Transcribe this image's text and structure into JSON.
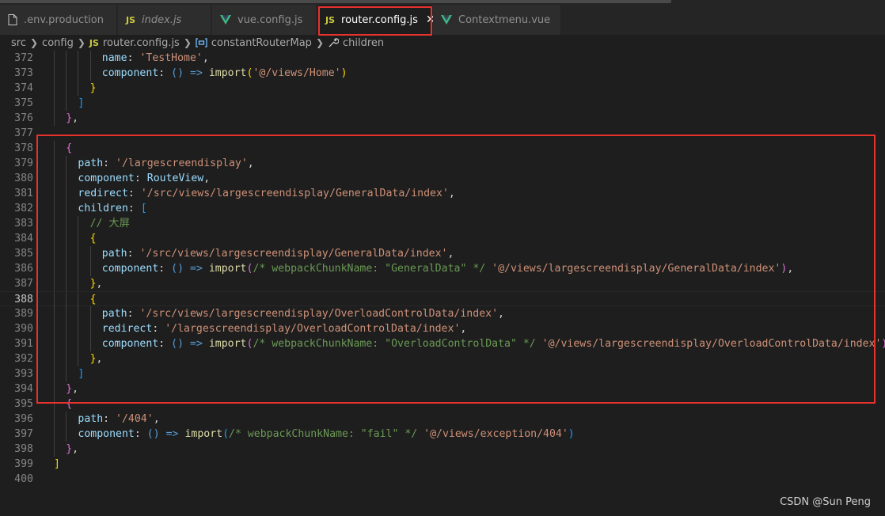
{
  "tabs": [
    {
      "label": ".env.production",
      "icon": "file-icon",
      "italic": false,
      "active": false
    },
    {
      "label": "index.js",
      "icon": "js-icon",
      "italic": true,
      "active": false
    },
    {
      "label": "vue.config.js",
      "icon": "vue-icon",
      "italic": false,
      "active": false
    },
    {
      "label": "router.config.js",
      "icon": "js-icon",
      "italic": false,
      "active": true
    },
    {
      "label": "Contextmenu.vue",
      "icon": "vue-icon",
      "italic": false,
      "active": false
    }
  ],
  "js_badge": "JS",
  "close_glyph": "✕",
  "breadcrumb": {
    "src": "src",
    "config": "config",
    "file": "router.config.js",
    "symbol1": "constantRouterMap",
    "symbol2": "children"
  },
  "lines": [
    {
      "n": "372",
      "indent": 4,
      "tokens": [
        [
          "k",
          "name"
        ],
        [
          "p",
          ": "
        ],
        [
          "s",
          "'TestHome'"
        ],
        [
          "p",
          ","
        ]
      ]
    },
    {
      "n": "373",
      "indent": 4,
      "tokens": [
        [
          "k",
          "component"
        ],
        [
          "p",
          ": "
        ],
        [
          "f",
          "()"
        ],
        [
          "p",
          " "
        ],
        [
          "f",
          "=>"
        ],
        [
          "p",
          " "
        ],
        [
          "fn",
          "import"
        ],
        [
          "b1",
          "("
        ],
        [
          "s",
          "'@/views/Home'"
        ],
        [
          "b1",
          ")"
        ]
      ]
    },
    {
      "n": "374",
      "indent": 3,
      "tokens": [
        [
          "b1",
          "}"
        ]
      ]
    },
    {
      "n": "375",
      "indent": 2,
      "tokens": [
        [
          "b3",
          "]"
        ]
      ]
    },
    {
      "n": "376",
      "indent": 1,
      "tokens": [
        [
          "b2",
          "}"
        ],
        [
          "p",
          ","
        ]
      ]
    },
    {
      "n": "377",
      "indent": 0,
      "tokens": []
    },
    {
      "n": "378",
      "indent": 1,
      "tokens": [
        [
          "b2",
          "{"
        ]
      ]
    },
    {
      "n": "379",
      "indent": 2,
      "tokens": [
        [
          "k",
          "path"
        ],
        [
          "p",
          ": "
        ],
        [
          "s",
          "'/largescreendisplay'"
        ],
        [
          "p",
          ","
        ]
      ]
    },
    {
      "n": "380",
      "indent": 2,
      "tokens": [
        [
          "k",
          "component"
        ],
        [
          "p",
          ": "
        ],
        [
          "k",
          "RouteView"
        ],
        [
          "p",
          ","
        ]
      ]
    },
    {
      "n": "381",
      "indent": 2,
      "tokens": [
        [
          "k",
          "redirect"
        ],
        [
          "p",
          ": "
        ],
        [
          "s",
          "'/src/views/largescreendisplay/GeneralData/index'"
        ],
        [
          "p",
          ","
        ]
      ]
    },
    {
      "n": "382",
      "indent": 2,
      "tokens": [
        [
          "k",
          "children"
        ],
        [
          "p",
          ": "
        ],
        [
          "b3",
          "["
        ]
      ]
    },
    {
      "n": "383",
      "indent": 3,
      "tokens": [
        [
          "c",
          "// 大屏"
        ]
      ]
    },
    {
      "n": "384",
      "indent": 3,
      "tokens": [
        [
          "b1",
          "{"
        ]
      ]
    },
    {
      "n": "385",
      "indent": 4,
      "tokens": [
        [
          "k",
          "path"
        ],
        [
          "p",
          ": "
        ],
        [
          "s",
          "'/src/views/largescreendisplay/GeneralData/index'"
        ],
        [
          "p",
          ","
        ]
      ]
    },
    {
      "n": "386",
      "indent": 4,
      "tokens": [
        [
          "k",
          "component"
        ],
        [
          "p",
          ": "
        ],
        [
          "f",
          "()"
        ],
        [
          "p",
          " "
        ],
        [
          "f",
          "=>"
        ],
        [
          "p",
          " "
        ],
        [
          "fn",
          "import"
        ],
        [
          "b2",
          "("
        ],
        [
          "c",
          "/* webpackChunkName: \"GeneralData\" */"
        ],
        [
          "p",
          " "
        ],
        [
          "s",
          "'@/views/largescreendisplay/GeneralData/index'"
        ],
        [
          "b2",
          ")"
        ],
        [
          "p",
          ","
        ]
      ]
    },
    {
      "n": "387",
      "indent": 3,
      "tokens": [
        [
          "b1",
          "}"
        ],
        [
          "p",
          ","
        ]
      ]
    },
    {
      "n": "388",
      "indent": 3,
      "tokens": [
        [
          "b1",
          "{"
        ]
      ],
      "current": true
    },
    {
      "n": "389",
      "indent": 4,
      "tokens": [
        [
          "k",
          "path"
        ],
        [
          "p",
          ": "
        ],
        [
          "s",
          "'/src/views/largescreendisplay/OverloadControlData/index'"
        ],
        [
          "p",
          ","
        ]
      ]
    },
    {
      "n": "390",
      "indent": 4,
      "tokens": [
        [
          "k",
          "redirect"
        ],
        [
          "p",
          ": "
        ],
        [
          "s",
          "'/largescreendisplay/OverloadControlData/index'"
        ],
        [
          "p",
          ","
        ]
      ]
    },
    {
      "n": "391",
      "indent": 4,
      "tokens": [
        [
          "k",
          "component"
        ],
        [
          "p",
          ": "
        ],
        [
          "f",
          "()"
        ],
        [
          "p",
          " "
        ],
        [
          "f",
          "=>"
        ],
        [
          "p",
          " "
        ],
        [
          "fn",
          "import"
        ],
        [
          "b2",
          "("
        ],
        [
          "c",
          "/* webpackChunkName: \"OverloadControlData\" */"
        ],
        [
          "p",
          " "
        ],
        [
          "s",
          "'@/views/largescreendisplay/OverloadControlData/index'"
        ],
        [
          "b2",
          ")"
        ]
      ]
    },
    {
      "n": "392",
      "indent": 3,
      "tokens": [
        [
          "b1",
          "}"
        ],
        [
          "p",
          ","
        ]
      ]
    },
    {
      "n": "393",
      "indent": 2,
      "tokens": [
        [
          "b3",
          "]"
        ]
      ]
    },
    {
      "n": "394",
      "indent": 1,
      "tokens": [
        [
          "b2",
          "}"
        ],
        [
          "p",
          ","
        ]
      ]
    },
    {
      "n": "395",
      "indent": 1,
      "tokens": [
        [
          "b2",
          "{"
        ]
      ]
    },
    {
      "n": "396",
      "indent": 2,
      "tokens": [
        [
          "k",
          "path"
        ],
        [
          "p",
          ": "
        ],
        [
          "s",
          "'/404'"
        ],
        [
          "p",
          ","
        ]
      ]
    },
    {
      "n": "397",
      "indent": 2,
      "tokens": [
        [
          "k",
          "component"
        ],
        [
          "p",
          ": "
        ],
        [
          "f",
          "()"
        ],
        [
          "p",
          " "
        ],
        [
          "f",
          "=>"
        ],
        [
          "p",
          " "
        ],
        [
          "fn",
          "import"
        ],
        [
          "b3",
          "("
        ],
        [
          "c",
          "/* webpackChunkName: \"fail\" */"
        ],
        [
          "p",
          " "
        ],
        [
          "s",
          "'@/views/exception/404'"
        ],
        [
          "b3",
          ")"
        ]
      ]
    },
    {
      "n": "398",
      "indent": 1,
      "tokens": [
        [
          "b2",
          "}"
        ],
        [
          "p",
          ","
        ]
      ]
    },
    {
      "n": "399",
      "indent": 0,
      "tokens": [
        [
          "b1",
          "]"
        ]
      ]
    },
    {
      "n": "400",
      "indent": 0,
      "tokens": []
    }
  ],
  "watermark": "CSDN @Sun   Peng",
  "colors": {
    "highlight": "#e8322e",
    "js_icon": "#cbcb41",
    "vue_icon": "#41b883"
  }
}
